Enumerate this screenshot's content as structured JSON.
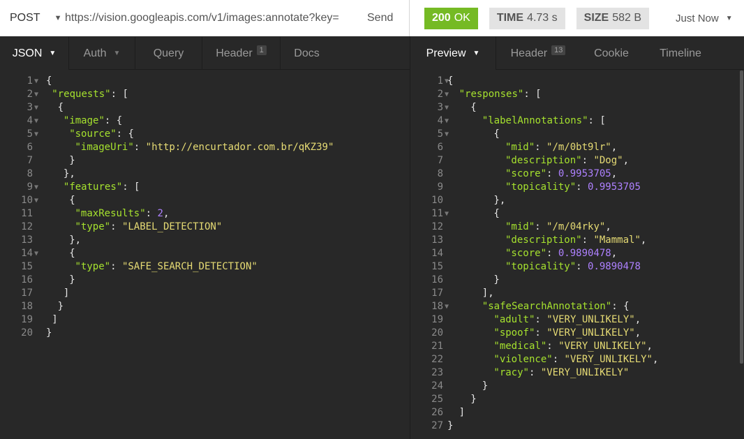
{
  "request": {
    "method": "POST",
    "url": "https://vision.googleapis.com/v1/images:annotate?key=",
    "send_label": "Send"
  },
  "response": {
    "status_code": "200",
    "status_text": "OK",
    "time_label": "TIME",
    "time_value": "4.73 s",
    "size_label": "SIZE",
    "size_value": "582 B",
    "history": "Just Now"
  },
  "left_tabs": {
    "json": "JSON",
    "auth": "Auth",
    "query": "Query",
    "header": "Header",
    "header_count": "1",
    "docs": "Docs"
  },
  "right_tabs": {
    "preview": "Preview",
    "header": "Header",
    "header_count": "13",
    "cookie": "Cookie",
    "timeline": "Timeline"
  },
  "colors": {
    "status_ok": "#75ba24",
    "key": "#a6e22e",
    "string": "#e6db74",
    "number": "#ae81ff"
  },
  "request_body": [
    {
      "n": "1",
      "indent": 0,
      "fold": true,
      "parts": [
        {
          "t": "p",
          "v": "{"
        }
      ]
    },
    {
      "n": "2",
      "indent": 1,
      "fold": true,
      "parts": [
        {
          "t": "k",
          "v": "\"requests\""
        },
        {
          "t": "p",
          "v": ": ["
        }
      ]
    },
    {
      "n": "3",
      "indent": 2,
      "fold": true,
      "parts": [
        {
          "t": "p",
          "v": "{"
        }
      ]
    },
    {
      "n": "4",
      "indent": 3,
      "fold": true,
      "parts": [
        {
          "t": "k",
          "v": "\"image\""
        },
        {
          "t": "p",
          "v": ": {"
        }
      ]
    },
    {
      "n": "5",
      "indent": 4,
      "fold": true,
      "parts": [
        {
          "t": "k",
          "v": "\"source\""
        },
        {
          "t": "p",
          "v": ": {"
        }
      ]
    },
    {
      "n": "6",
      "indent": 5,
      "fold": false,
      "parts": [
        {
          "t": "k",
          "v": "\"imageUri\""
        },
        {
          "t": "p",
          "v": ": "
        },
        {
          "t": "s",
          "v": "\"http://encurtador.com.br/qKZ39\""
        }
      ]
    },
    {
      "n": "7",
      "indent": 4,
      "fold": false,
      "parts": [
        {
          "t": "p",
          "v": "}"
        }
      ]
    },
    {
      "n": "8",
      "indent": 3,
      "fold": false,
      "parts": [
        {
          "t": "p",
          "v": "},"
        }
      ]
    },
    {
      "n": "9",
      "indent": 3,
      "fold": true,
      "parts": [
        {
          "t": "k",
          "v": "\"features\""
        },
        {
          "t": "p",
          "v": ": ["
        }
      ]
    },
    {
      "n": "10",
      "indent": 4,
      "fold": true,
      "parts": [
        {
          "t": "p",
          "v": "{"
        }
      ]
    },
    {
      "n": "11",
      "indent": 5,
      "fold": false,
      "parts": [
        {
          "t": "k",
          "v": "\"maxResults\""
        },
        {
          "t": "p",
          "v": ": "
        },
        {
          "t": "n",
          "v": "2"
        },
        {
          "t": "p",
          "v": ","
        }
      ]
    },
    {
      "n": "12",
      "indent": 5,
      "fold": false,
      "parts": [
        {
          "t": "k",
          "v": "\"type\""
        },
        {
          "t": "p",
          "v": ": "
        },
        {
          "t": "s",
          "v": "\"LABEL_DETECTION\""
        }
      ]
    },
    {
      "n": "13",
      "indent": 4,
      "fold": false,
      "parts": [
        {
          "t": "p",
          "v": "},"
        }
      ]
    },
    {
      "n": "14",
      "indent": 4,
      "fold": true,
      "parts": [
        {
          "t": "p",
          "v": "{"
        }
      ]
    },
    {
      "n": "15",
      "indent": 5,
      "fold": false,
      "parts": [
        {
          "t": "k",
          "v": "\"type\""
        },
        {
          "t": "p",
          "v": ": "
        },
        {
          "t": "s",
          "v": "\"SAFE_SEARCH_DETECTION\""
        }
      ]
    },
    {
      "n": "16",
      "indent": 4,
      "fold": false,
      "parts": [
        {
          "t": "p",
          "v": "}"
        }
      ]
    },
    {
      "n": "17",
      "indent": 3,
      "fold": false,
      "parts": [
        {
          "t": "p",
          "v": "]"
        }
      ]
    },
    {
      "n": "18",
      "indent": 2,
      "fold": false,
      "parts": [
        {
          "t": "p",
          "v": "}"
        }
      ]
    },
    {
      "n": "19",
      "indent": 1,
      "fold": false,
      "parts": [
        {
          "t": "p",
          "v": "]"
        }
      ]
    },
    {
      "n": "20",
      "indent": 0,
      "fold": false,
      "parts": [
        {
          "t": "p",
          "v": "}"
        }
      ]
    }
  ],
  "response_body": [
    {
      "n": "1",
      "indent": 0,
      "fold": true,
      "parts": [
        {
          "t": "p",
          "v": "{"
        }
      ]
    },
    {
      "n": "2",
      "indent": 1,
      "fold": true,
      "parts": [
        {
          "t": "k",
          "v": "\"responses\""
        },
        {
          "t": "p",
          "v": ": ["
        }
      ]
    },
    {
      "n": "3",
      "indent": 2,
      "fold": true,
      "parts": [
        {
          "t": "p",
          "v": "{"
        }
      ]
    },
    {
      "n": "4",
      "indent": 3,
      "fold": true,
      "parts": [
        {
          "t": "k",
          "v": "\"labelAnnotations\""
        },
        {
          "t": "p",
          "v": ": ["
        }
      ]
    },
    {
      "n": "5",
      "indent": 4,
      "fold": true,
      "parts": [
        {
          "t": "p",
          "v": "{"
        }
      ]
    },
    {
      "n": "6",
      "indent": 5,
      "fold": false,
      "parts": [
        {
          "t": "k",
          "v": "\"mid\""
        },
        {
          "t": "p",
          "v": ": "
        },
        {
          "t": "s",
          "v": "\"/m/0bt9lr\""
        },
        {
          "t": "p",
          "v": ","
        }
      ]
    },
    {
      "n": "7",
      "indent": 5,
      "fold": false,
      "parts": [
        {
          "t": "k",
          "v": "\"description\""
        },
        {
          "t": "p",
          "v": ": "
        },
        {
          "t": "s",
          "v": "\"Dog\""
        },
        {
          "t": "p",
          "v": ","
        }
      ]
    },
    {
      "n": "8",
      "indent": 5,
      "fold": false,
      "parts": [
        {
          "t": "k",
          "v": "\"score\""
        },
        {
          "t": "p",
          "v": ": "
        },
        {
          "t": "n",
          "v": "0.9953705"
        },
        {
          "t": "p",
          "v": ","
        }
      ]
    },
    {
      "n": "9",
      "indent": 5,
      "fold": false,
      "parts": [
        {
          "t": "k",
          "v": "\"topicality\""
        },
        {
          "t": "p",
          "v": ": "
        },
        {
          "t": "n",
          "v": "0.9953705"
        }
      ]
    },
    {
      "n": "10",
      "indent": 4,
      "fold": false,
      "parts": [
        {
          "t": "p",
          "v": "},"
        }
      ]
    },
    {
      "n": "11",
      "indent": 4,
      "fold": true,
      "parts": [
        {
          "t": "p",
          "v": "{"
        }
      ]
    },
    {
      "n": "12",
      "indent": 5,
      "fold": false,
      "parts": [
        {
          "t": "k",
          "v": "\"mid\""
        },
        {
          "t": "p",
          "v": ": "
        },
        {
          "t": "s",
          "v": "\"/m/04rky\""
        },
        {
          "t": "p",
          "v": ","
        }
      ]
    },
    {
      "n": "13",
      "indent": 5,
      "fold": false,
      "parts": [
        {
          "t": "k",
          "v": "\"description\""
        },
        {
          "t": "p",
          "v": ": "
        },
        {
          "t": "s",
          "v": "\"Mammal\""
        },
        {
          "t": "p",
          "v": ","
        }
      ]
    },
    {
      "n": "14",
      "indent": 5,
      "fold": false,
      "parts": [
        {
          "t": "k",
          "v": "\"score\""
        },
        {
          "t": "p",
          "v": ": "
        },
        {
          "t": "n",
          "v": "0.9890478"
        },
        {
          "t": "p",
          "v": ","
        }
      ]
    },
    {
      "n": "15",
      "indent": 5,
      "fold": false,
      "parts": [
        {
          "t": "k",
          "v": "\"topicality\""
        },
        {
          "t": "p",
          "v": ": "
        },
        {
          "t": "n",
          "v": "0.9890478"
        }
      ]
    },
    {
      "n": "16",
      "indent": 4,
      "fold": false,
      "parts": [
        {
          "t": "p",
          "v": "}"
        }
      ]
    },
    {
      "n": "17",
      "indent": 3,
      "fold": false,
      "parts": [
        {
          "t": "p",
          "v": "],"
        }
      ]
    },
    {
      "n": "18",
      "indent": 3,
      "fold": true,
      "parts": [
        {
          "t": "k",
          "v": "\"safeSearchAnnotation\""
        },
        {
          "t": "p",
          "v": ": {"
        }
      ]
    },
    {
      "n": "19",
      "indent": 4,
      "fold": false,
      "parts": [
        {
          "t": "k",
          "v": "\"adult\""
        },
        {
          "t": "p",
          "v": ": "
        },
        {
          "t": "s",
          "v": "\"VERY_UNLIKELY\""
        },
        {
          "t": "p",
          "v": ","
        }
      ]
    },
    {
      "n": "20",
      "indent": 4,
      "fold": false,
      "parts": [
        {
          "t": "k",
          "v": "\"spoof\""
        },
        {
          "t": "p",
          "v": ": "
        },
        {
          "t": "s",
          "v": "\"VERY_UNLIKELY\""
        },
        {
          "t": "p",
          "v": ","
        }
      ]
    },
    {
      "n": "21",
      "indent": 4,
      "fold": false,
      "parts": [
        {
          "t": "k",
          "v": "\"medical\""
        },
        {
          "t": "p",
          "v": ": "
        },
        {
          "t": "s",
          "v": "\"VERY_UNLIKELY\""
        },
        {
          "t": "p",
          "v": ","
        }
      ]
    },
    {
      "n": "22",
      "indent": 4,
      "fold": false,
      "parts": [
        {
          "t": "k",
          "v": "\"violence\""
        },
        {
          "t": "p",
          "v": ": "
        },
        {
          "t": "s",
          "v": "\"VERY_UNLIKELY\""
        },
        {
          "t": "p",
          "v": ","
        }
      ]
    },
    {
      "n": "23",
      "indent": 4,
      "fold": false,
      "parts": [
        {
          "t": "k",
          "v": "\"racy\""
        },
        {
          "t": "p",
          "v": ": "
        },
        {
          "t": "s",
          "v": "\"VERY_UNLIKELY\""
        }
      ]
    },
    {
      "n": "24",
      "indent": 3,
      "fold": false,
      "parts": [
        {
          "t": "p",
          "v": "}"
        }
      ]
    },
    {
      "n": "25",
      "indent": 2,
      "fold": false,
      "parts": [
        {
          "t": "p",
          "v": "}"
        }
      ]
    },
    {
      "n": "26",
      "indent": 1,
      "fold": false,
      "parts": [
        {
          "t": "p",
          "v": "]"
        }
      ]
    },
    {
      "n": "27",
      "indent": 0,
      "fold": false,
      "parts": [
        {
          "t": "p",
          "v": "}"
        }
      ]
    }
  ]
}
